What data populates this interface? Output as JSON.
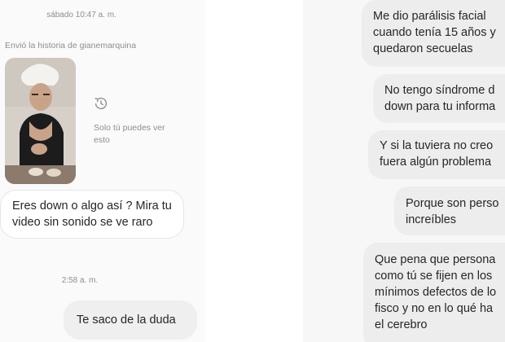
{
  "left": {
    "timestamp_top": "sábado 10:47 a. m.",
    "story_caption": "Envió la historia de gianemarquina",
    "story_expired_text": "Solo tú puedes ver esto",
    "story_expired_icon": "history-expired-icon",
    "message_received": "Eres down o algo así ? Mira tu video sin sonido se ve raro",
    "timestamp_mid": "2:58 a. m.",
    "message_sent": "Te saco de la duda"
  },
  "right": {
    "messages": [
      "Me dio parálisis facial\ncuando tenía 15 años y\nquedaron secuelas",
      "No tengo síndrome d\ndown para tu informa",
      "Y si la tuviera no creo\nfuera algún problema",
      "Porque son perso\nincreíbles",
      "Que pena que persona\ncomo tú se fijen en los\nmínimos defectos de lo\nfisco y no en lo qué ha\nel cerebro"
    ]
  },
  "colors": {
    "bubble_right": "#ededed",
    "bubble_sent": "#efefef",
    "bubble_received_border": "#e6e6e6",
    "meta_text": "#8e8e8e"
  }
}
